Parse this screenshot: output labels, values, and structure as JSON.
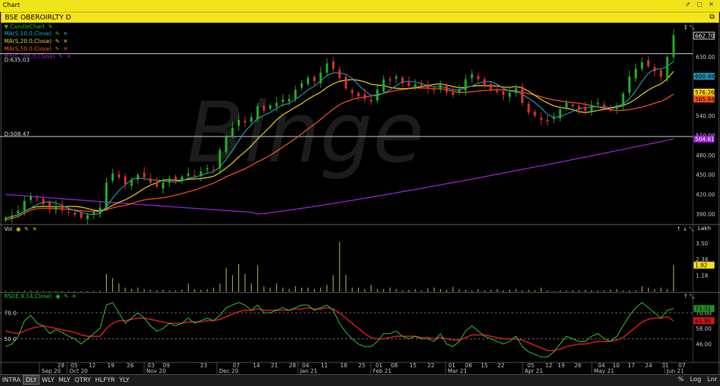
{
  "window": {
    "title": "Chart",
    "controls": "⇗ ▢ ✕"
  },
  "symbol_bar": {
    "symbol": "BSE OBEROIRLTY D"
  },
  "legend": {
    "candle": "CandleChart",
    "ma10": "MA(S,10.0,Close)",
    "ma20": "MA(S,20.0,Close)",
    "ma50": "MA(S,50.0,Close)",
    "ma200": "MA(S,200.0,Close)",
    "d_high": "D:635.03",
    "d_low": "D:508.47",
    "vol": "Vol",
    "rsi": "RSI(E,9,14,Close)",
    "lakh": "Lakh"
  },
  "colors": {
    "up": "#22b222",
    "down": "#e53030",
    "ma10": "#1fb0c8",
    "ma20": "#f2d21c",
    "ma50": "#ff5520",
    "ma200": "#9b1fd8",
    "volume": "#c8c86a",
    "rsi": "#2fc42f",
    "rsi_signal": "#e01a1a"
  },
  "bottom_tabs": [
    "INTRA",
    "DLY",
    "WLY",
    "MLY",
    "QTRY",
    "HLFYR",
    "YLY"
  ],
  "active_tab": "DLY",
  "bottom_right": "% Log Lnr",
  "chart_data": [
    {
      "type": "candlestick",
      "series": [
        {
          "name": "CandleChart"
        },
        {
          "name": "MA(S,10.0,Close)",
          "last": 600.49
        },
        {
          "name": "MA(S,20.0,Close)",
          "last": 576.26
        },
        {
          "name": "MA(S,50.0,Close)",
          "last": 565.84
        },
        {
          "name": "MA(S,200.0,Close)",
          "last": 504.61
        }
      ],
      "last_close": 662.7,
      "ylim": [
        375,
        680
      ],
      "yticks": [
        390,
        420,
        450,
        480,
        510,
        540,
        570,
        600,
        630
      ],
      "y_tick_labels": [
        "390.00",
        "420.00",
        "450.00",
        "480.00",
        "510.00",
        "540.00",
        "570.00",
        "600.00",
        "630.00"
      ],
      "price_labels": [
        "662.70",
        "600.49",
        "576.26",
        "565.84",
        "504.61"
      ],
      "annotations": {
        "high_line": 635.03,
        "low_line": 508.47
      },
      "closes": [
        384,
        388,
        395,
        410,
        417,
        413,
        405,
        398,
        402,
        396,
        392,
        389,
        384,
        388,
        393,
        400,
        438,
        452,
        446,
        436,
        442,
        450,
        446,
        438,
        432,
        438,
        444,
        442,
        447,
        452,
        448,
        455,
        460,
        458,
        488,
        508,
        522,
        534,
        530,
        538,
        555,
        548,
        556,
        560,
        565,
        566,
        580,
        590,
        598,
        593,
        606,
        620,
        612,
        598,
        582,
        575,
        570,
        566,
        562,
        580,
        596,
        594,
        600,
        590,
        586,
        588,
        585,
        582,
        580,
        590,
        576,
        572,
        580,
        596,
        604,
        596,
        586,
        580,
        576,
        572,
        575,
        582,
        560,
        545,
        540,
        534,
        532,
        538,
        550,
        560,
        555,
        550,
        548,
        556,
        560,
        552,
        548,
        556,
        574,
        600,
        612,
        622,
        616,
        608,
        600,
        630,
        663
      ]
    },
    {
      "type": "bar",
      "series": [
        {
          "name": "Vol"
        }
      ],
      "last": 1.92,
      "ylim": [
        0,
        4.5
      ],
      "yticks": [
        1.18,
        2.34,
        3.5
      ],
      "y_tick_labels": [
        "1.18",
        "2.34",
        "3.50"
      ],
      "last_label": "1.92",
      "unit": "Lakh",
      "values": [
        0.05,
        0.06,
        0.05,
        0.08,
        0.1,
        0.07,
        0.06,
        0.05,
        0.06,
        0.05,
        0.06,
        0.05,
        0.05,
        0.05,
        0.06,
        0.08,
        1.3,
        1.0,
        0.6,
        0.3,
        0.2,
        0.3,
        0.2,
        0.15,
        0.1,
        0.15,
        0.1,
        0.1,
        0.15,
        0.6,
        0.2,
        0.15,
        0.2,
        0.3,
        0.6,
        1.7,
        1.2,
        2.0,
        1.3,
        0.6,
        1.9,
        0.4,
        0.3,
        0.6,
        0.3,
        0.2,
        0.4,
        0.3,
        0.3,
        0.2,
        0.3,
        0.5,
        1.2,
        3.6,
        1.2,
        0.3,
        0.3,
        0.2,
        0.5,
        0.2,
        0.2,
        0.3,
        0.2,
        0.1,
        0.15,
        0.2,
        0.1,
        0.25,
        0.3,
        0.2,
        0.15,
        0.35,
        0.2,
        0.15,
        0.1,
        0.2,
        0.1,
        0.15,
        0.2,
        0.1,
        0.15,
        0.2,
        0.1,
        0.15,
        0.1,
        0.3,
        0.1,
        0.05,
        0.1,
        0.1,
        0.1,
        0.1,
        0.15,
        0.1,
        0.1,
        0.1,
        0.15,
        0.2,
        0.1,
        0.1,
        0.1,
        0.4,
        0.3,
        0.2,
        0.3,
        0.2,
        1.92
      ]
    },
    {
      "type": "line",
      "series": [
        {
          "name": "RSI(E,9,14,Close)",
          "last": 73.31
        },
        {
          "name": "signal",
          "last": 63.96
        }
      ],
      "ylim": [
        35,
        82
      ],
      "yticks": [
        46,
        58,
        70
      ],
      "y_tick_labels": [
        "46.00",
        "58.00",
        "70.00"
      ],
      "dashed_levels": [
        70,
        50
      ],
      "left_labels": [
        "70.0",
        "50.0"
      ],
      "value_labels": [
        "73.31",
        "63.96"
      ],
      "rsi": [
        44,
        46,
        52,
        64,
        68,
        62,
        60,
        54,
        57,
        55,
        52,
        50,
        46,
        50,
        54,
        58,
        76,
        78,
        70,
        62,
        66,
        70,
        66,
        60,
        56,
        58,
        62,
        60,
        62,
        66,
        62,
        64,
        66,
        64,
        68,
        74,
        76,
        78,
        76,
        72,
        76,
        70,
        70,
        72,
        74,
        72,
        74,
        76,
        76,
        72,
        74,
        76,
        72,
        62,
        55,
        50,
        46,
        44,
        44,
        48,
        54,
        54,
        56,
        52,
        50,
        52,
        50,
        50,
        48,
        54,
        46,
        44,
        48,
        56,
        60,
        56,
        52,
        50,
        48,
        46,
        48,
        52,
        44,
        40,
        38,
        36,
        36,
        40,
        46,
        52,
        50,
        48,
        48,
        52,
        54,
        50,
        48,
        52,
        60,
        68,
        74,
        78,
        74,
        70,
        66,
        72,
        73.31
      ],
      "signal": [
        56,
        55,
        54,
        56,
        58,
        59,
        60,
        59,
        58,
        57,
        56,
        55,
        53,
        52,
        52,
        52,
        58,
        62,
        64,
        64,
        65,
        66,
        66,
        65,
        64,
        63,
        62,
        62,
        62,
        63,
        63,
        63,
        64,
        64,
        65,
        67,
        69,
        71,
        72,
        72,
        73,
        72,
        72,
        72,
        72,
        72,
        73,
        73,
        74,
        73,
        73,
        74,
        73,
        70,
        66,
        62,
        58,
        54,
        51,
        50,
        50,
        51,
        52,
        52,
        52,
        52,
        51,
        51,
        50,
        51,
        50,
        49,
        49,
        51,
        53,
        53,
        53,
        52,
        51,
        50,
        50,
        50,
        49,
        47,
        45,
        43,
        41,
        41,
        42,
        44,
        45,
        46,
        46,
        47,
        48,
        48,
        48,
        49,
        51,
        55,
        59,
        63,
        65,
        66,
        66,
        67,
        63.96
      ]
    }
  ],
  "x_axis": {
    "day_labels": [
      "28",
      "05",
      "12",
      "19",
      "26",
      "03",
      "09",
      "23",
      "07",
      "14",
      "21",
      "28",
      "04",
      "11",
      "18",
      "25",
      "01",
      "08",
      "15",
      "22",
      "01",
      "08",
      "15",
      "22",
      "05",
      "12",
      "19",
      "26",
      "04",
      "10",
      "17",
      "24",
      "31",
      "07"
    ],
    "month_labels": [
      "Sep 20",
      "Oct 20",
      "Nov 20",
      "Dec 20",
      "Jan 21",
      "Feb 21",
      "Mar 21",
      "Apr 21",
      "May 21",
      "Jun 21"
    ]
  },
  "watermark": "Binge"
}
